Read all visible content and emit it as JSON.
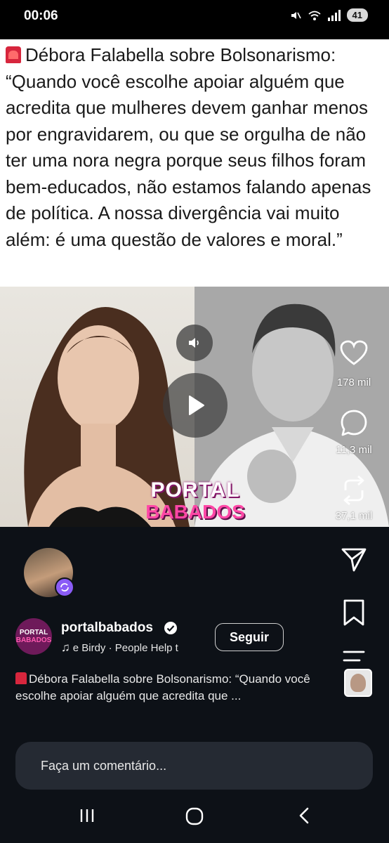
{
  "status_bar": {
    "time": "00:06",
    "battery": "41"
  },
  "post": {
    "headline": "Débora Falabella sobre Bolsonarismo: “Quando você escolhe apoiar alguém que acredita que mulheres devem ganhar menos por engravidarem, ou que se orgulha de não ter uma nora negra porque seus filhos foram bem-educados, não estamos falando apenas de política. A nossa divergência vai muito além: é uma questão de valores e moral.”",
    "logo_line1": "PORTAL",
    "logo_line2": "BABADOS"
  },
  "actions": {
    "likes": "178 mil",
    "comments": "11,3 mil",
    "reposts": "37,1 mil"
  },
  "account": {
    "avatar_line1": "PORTAL",
    "avatar_line2": "BABADOS",
    "username": "portalbabados",
    "music": "e   Birdy · People Help t",
    "follow_label": "Seguir"
  },
  "caption": {
    "text": "Débora Falabella sobre Bolsonarismo: “Quando você escolhe apoiar alguém que acredita que ..."
  },
  "comment_input": {
    "placeholder": "Faça um comentário..."
  },
  "colors": {
    "footer_bg": "#0d1117",
    "comment_box_bg": "#252a33",
    "brand_pink": "#ff47a6",
    "remix_badge": "#8a5cf6"
  },
  "icons": [
    "mute-icon",
    "wifi-icon",
    "signal-icon",
    "sound-icon",
    "play-icon",
    "heart-icon",
    "comment-icon",
    "repost-icon",
    "send-icon",
    "bookmark-icon",
    "menu-icon",
    "verified-icon",
    "music-note-icon",
    "recents-icon",
    "home-icon",
    "back-icon"
  ]
}
